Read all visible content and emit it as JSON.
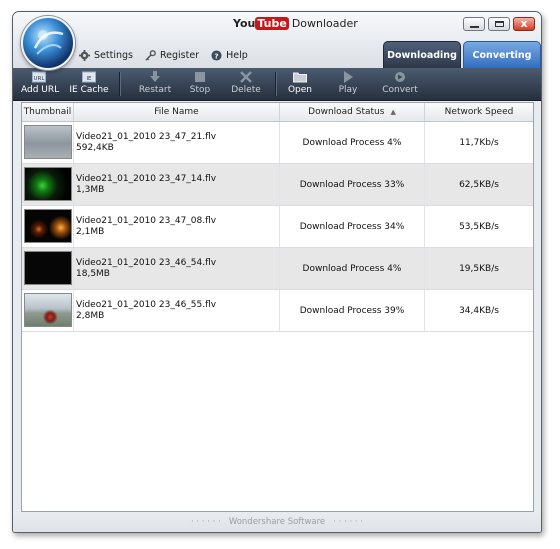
{
  "window": {
    "title_you": "You",
    "title_tube": "Tube",
    "title_rest": "Downloader"
  },
  "menu": {
    "settings": "Settings",
    "register": "Register",
    "help": "Help"
  },
  "tabs": [
    "Downloading",
    "Converting"
  ],
  "toolbar": {
    "add_url": "Add URL",
    "add_url_icon_text": "URL",
    "ie_cache": "IE Cache",
    "ie_cache_icon_text": "IE",
    "restart": "Restart",
    "stop": "Stop",
    "delete": "Delete",
    "open": "Open",
    "play": "Play",
    "convert": "Convert"
  },
  "columns": [
    "Thumbnail",
    "File Name",
    "Download Status",
    "Network Speed"
  ],
  "rows": [
    {
      "file": "Video21_01_2010 23_47_21.flv",
      "size": "592,4KB",
      "status": "Download Process 4%",
      "speed": "11,7Kb/s",
      "thumb": "gray-still"
    },
    {
      "file": "Video21_01_2010 23_47_14.flv",
      "size": "1,3MB",
      "status": "Download Process 33%",
      "speed": "62,5KB/s",
      "thumb": "night-green"
    },
    {
      "file": "Video21_01_2010 23_47_08.flv",
      "size": "2,1MB",
      "status": "Download Process 34%",
      "speed": "53,5KB/s",
      "thumb": "night-lights"
    },
    {
      "file": "Video21_01_2010 23_46_54.flv",
      "size": "18,5MB",
      "status": "Download Process 4%",
      "speed": "19,5KB/s",
      "thumb": "black"
    },
    {
      "file": "Video21_01_2010 23_46_55.flv",
      "size": "2,8MB",
      "status": "Download Process 39%",
      "speed": "34,4KB/s",
      "thumb": "motorbike"
    }
  ],
  "footer": "Wondershare Software"
}
